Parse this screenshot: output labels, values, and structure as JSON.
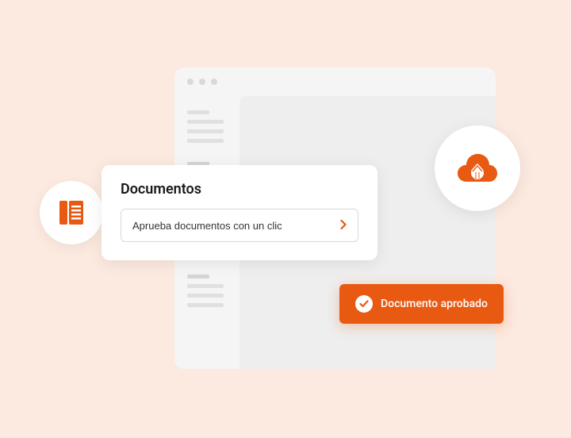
{
  "colors": {
    "accent": "#e85912",
    "background": "#fce9df"
  },
  "card": {
    "title": "Documentos",
    "button_text": "Aprueba documentos con un clic"
  },
  "badge": {
    "text": "Documento aprobado"
  },
  "icons": {
    "document": "document-icon",
    "cloud_upload": "cloud-upload-icon",
    "check": "check-icon",
    "chevron_right": "chevron-right-icon"
  }
}
